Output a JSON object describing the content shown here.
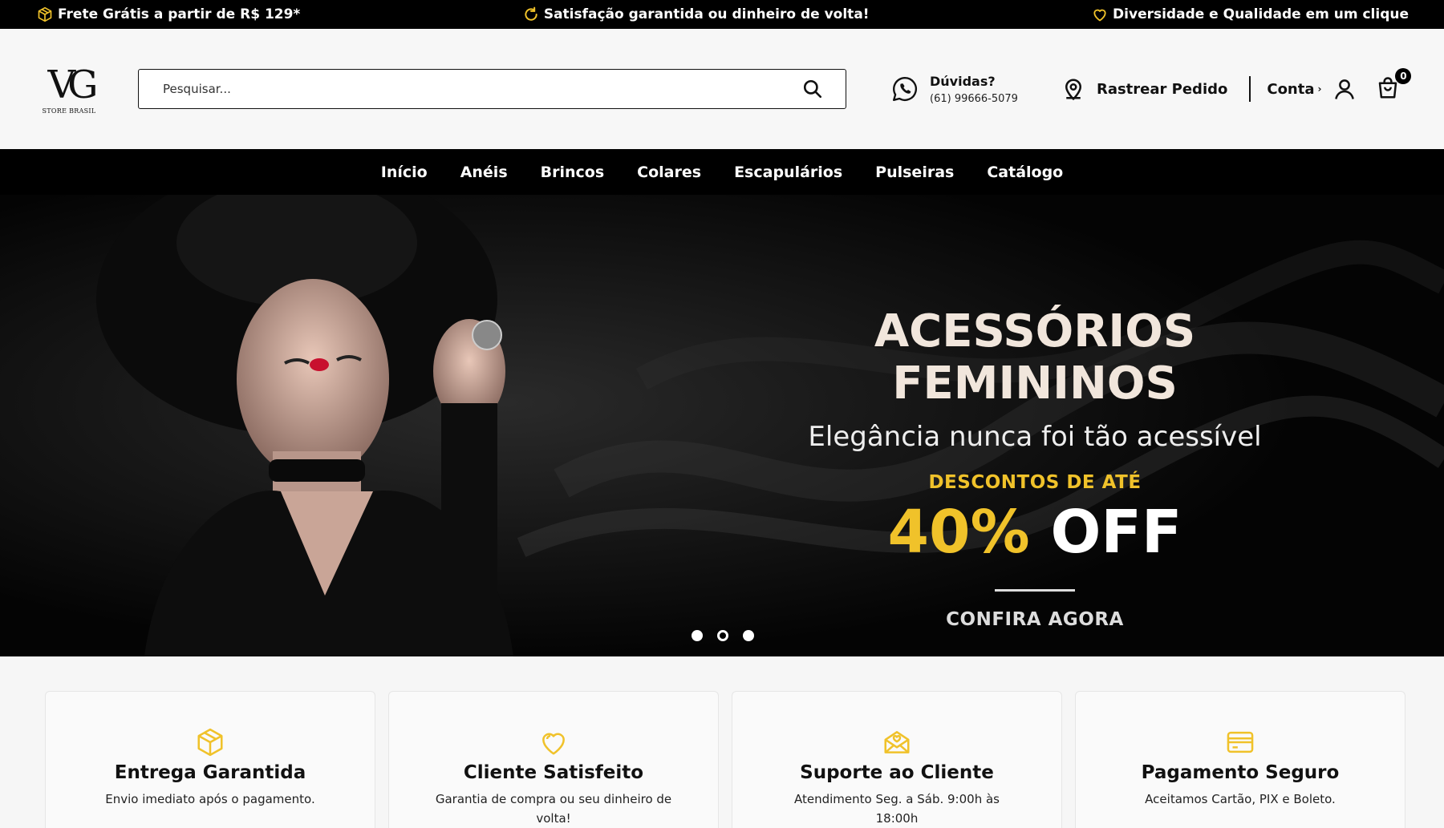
{
  "announcements": [
    {
      "icon": "box-icon",
      "text": "Frete Grátis a partir de R$ 129*"
    },
    {
      "icon": "refresh-icon",
      "text": "Satisfação garantida ou dinheiro de volta!"
    },
    {
      "icon": "heart-icon",
      "text": "Diversidade e Qualidade em um clique"
    }
  ],
  "logo": {
    "monogram": "VG",
    "subtitle": "STORE BRASIL"
  },
  "search": {
    "placeholder": "Pesquisar..."
  },
  "help": {
    "title": "Dúvidas?",
    "phone": "(61) 99666-5079"
  },
  "track": {
    "label": "Rastrear Pedido"
  },
  "account": {
    "label": "Conta",
    "chevron": "›"
  },
  "cart": {
    "count": "0"
  },
  "nav": [
    "Início",
    "Anéis",
    "Brincos",
    "Colares",
    "Escapulários",
    "Pulseiras",
    "Catálogo"
  ],
  "hero": {
    "title": "ACESSÓRIOS FEMININOS",
    "subtitle": "Elegância nunca foi tão acessível",
    "discount_label": "DESCONTOS DE ATÉ",
    "discount_pct": "40%",
    "discount_off": "OFF",
    "cta": "CONFIRA AGORA",
    "slides": 3,
    "active_slide": 2
  },
  "features": [
    {
      "icon": "box-icon",
      "title": "Entrega Garantida",
      "desc": "Envio imediato após o pagamento."
    },
    {
      "icon": "heart-icon",
      "title": "Cliente Satisfeito",
      "desc": "Garantia de compra ou seu dinheiro de volta!"
    },
    {
      "icon": "mail-heart-icon",
      "title": "Suporte ao Cliente",
      "desc": "Atendimento Seg. a Sáb. 9:00h às 18:00h"
    },
    {
      "icon": "credit-card-icon",
      "title": "Pagamento Seguro",
      "desc": "Aceitamos Cartão, PIX e Boleto."
    }
  ],
  "colors": {
    "accent": "#f0c22a",
    "black": "#000000",
    "background": "#f6f6f6"
  }
}
